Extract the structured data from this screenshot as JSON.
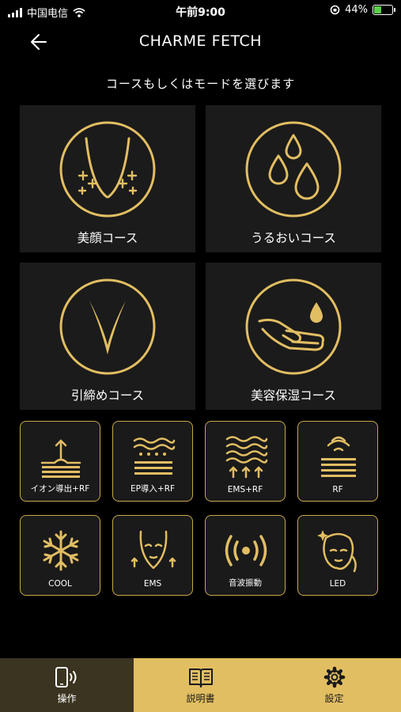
{
  "status_bar": {
    "carrier": "中国电信",
    "time": "午前9:00",
    "battery": "44%",
    "battery_level": 0.44
  },
  "header": {
    "title": "CHARME FETCH"
  },
  "subtitle": "コースもしくはモードを選びます",
  "courses": [
    {
      "label": "美顔コース",
      "icon": "face-contour-icon"
    },
    {
      "label": "うるおいコース",
      "icon": "water-drops-icon"
    },
    {
      "label": "引締めコース",
      "icon": "v-line-icon"
    },
    {
      "label": "美容保湿コース",
      "icon": "hand-drop-icon"
    }
  ],
  "modes": [
    {
      "label": "イオン導出+RF",
      "icon": "ion-out-icon"
    },
    {
      "label": "EP導入+RF",
      "icon": "ep-in-icon"
    },
    {
      "label": "EMS+RF",
      "icon": "ems-rf-icon"
    },
    {
      "label": "RF",
      "icon": "rf-icon"
    },
    {
      "label": "COOL",
      "icon": "snowflake-icon"
    },
    {
      "label": "EMS",
      "icon": "ems-face-icon"
    },
    {
      "label": "音波振動",
      "icon": "sonic-vibration-icon"
    },
    {
      "label": "LED",
      "icon": "led-face-icon"
    }
  ],
  "tabs": [
    {
      "label": "操作",
      "icon": "phone-signal-icon",
      "active": true
    },
    {
      "label": "説明書",
      "icon": "book-icon",
      "active": false
    },
    {
      "label": "設定",
      "icon": "gear-icon",
      "active": false
    }
  ],
  "colors": {
    "gold": "#e2be62",
    "card": "#1b1b1b",
    "tab_active": "#3a3420"
  }
}
